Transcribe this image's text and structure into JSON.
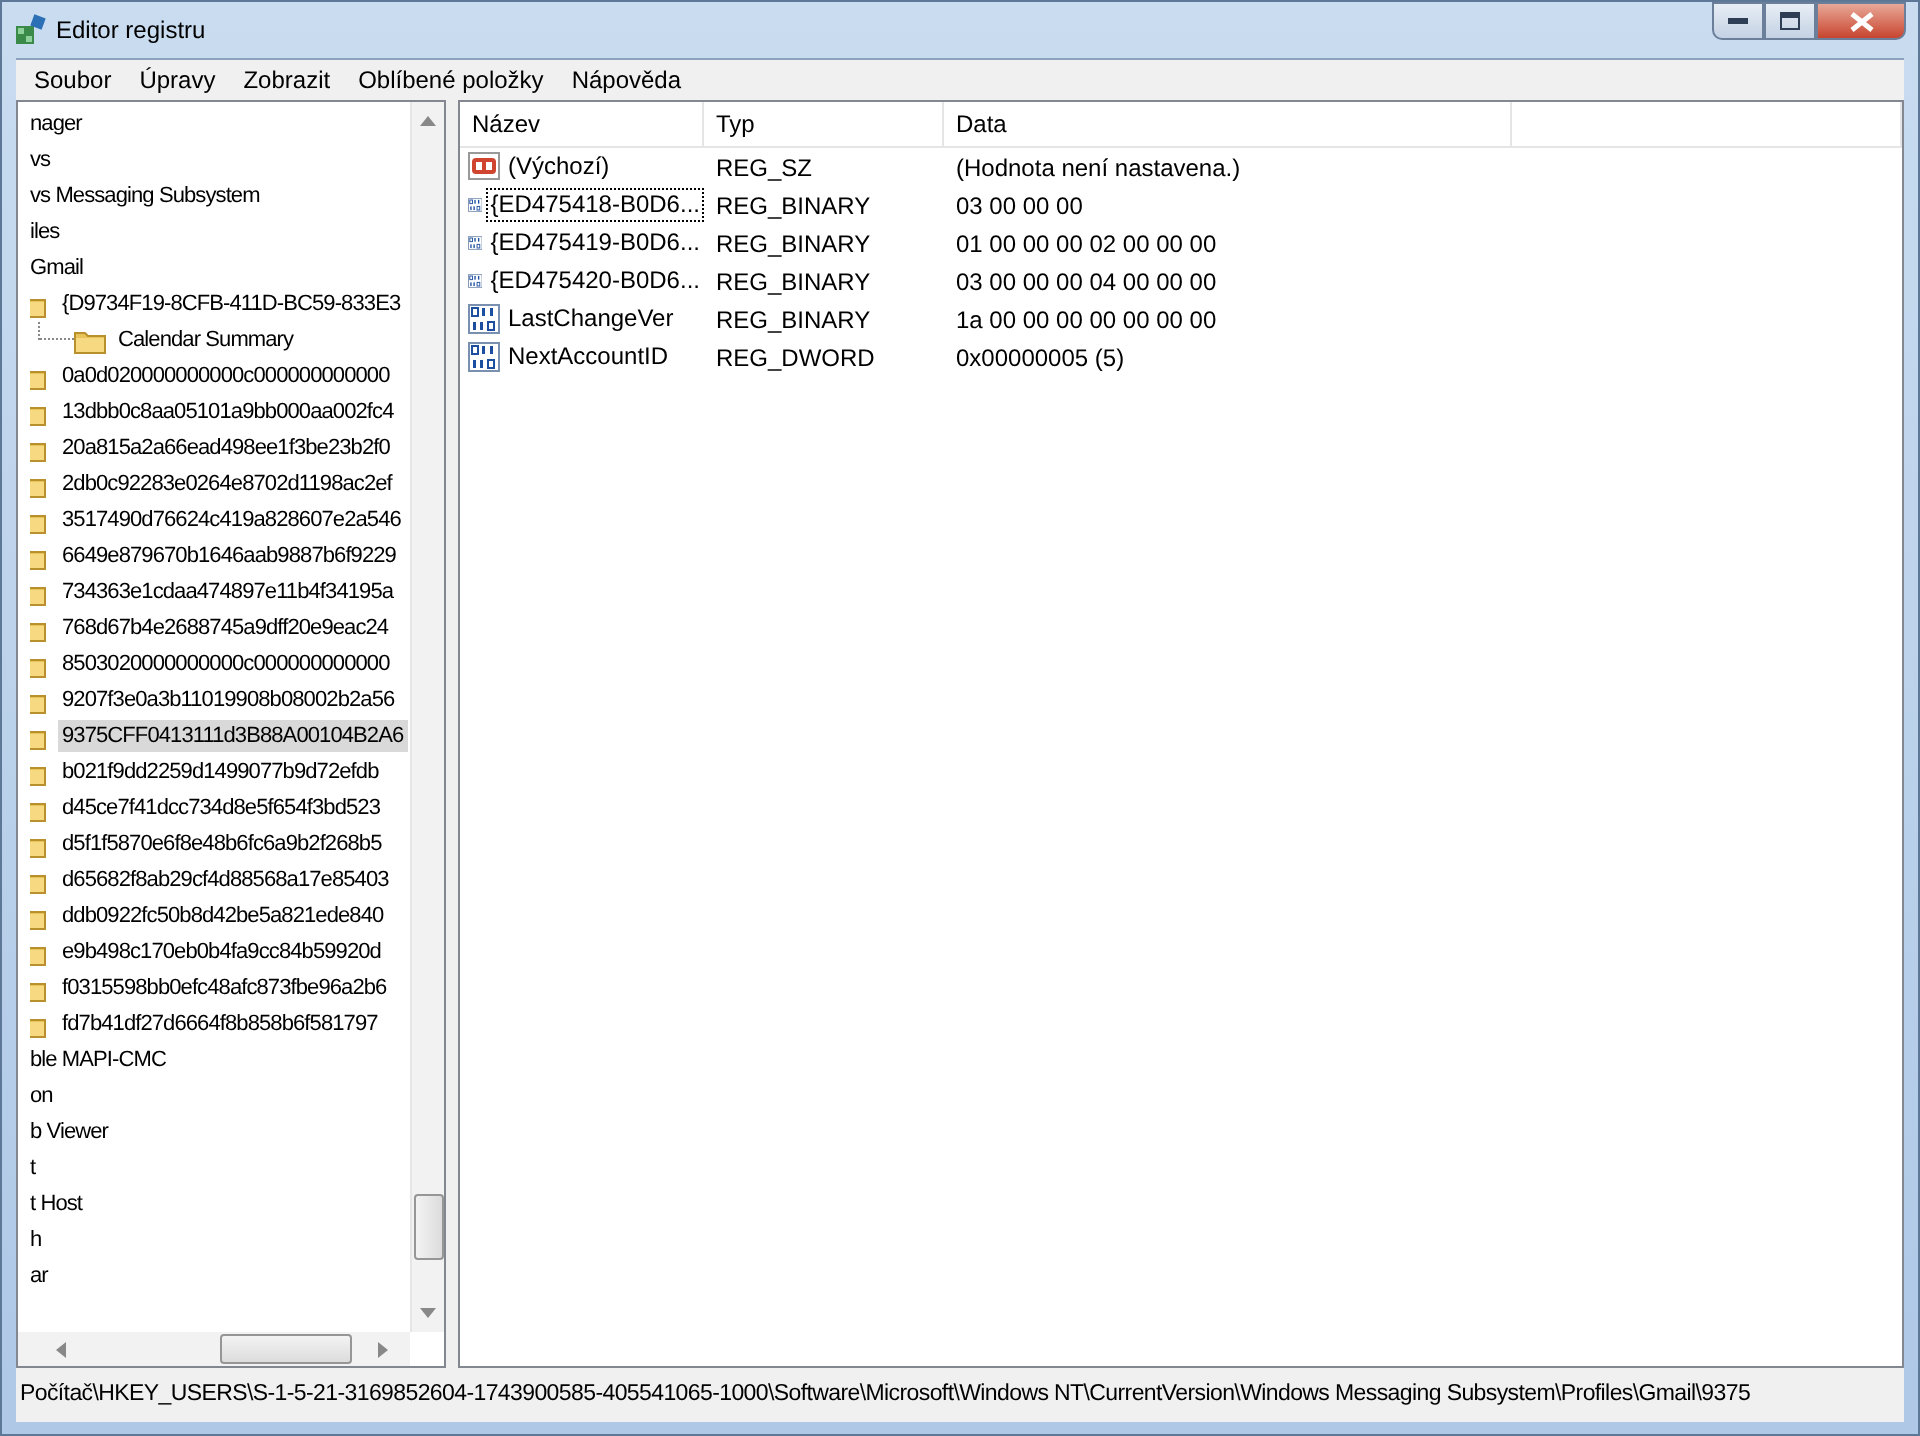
{
  "window": {
    "title": "Editor registru"
  },
  "menu": [
    "Soubor",
    "Úpravy",
    "Zobrazit",
    "Oblíbené položky",
    "Nápověda"
  ],
  "tree": [
    {
      "label": "nager",
      "selected": false
    },
    {
      "label": "vs",
      "selected": false
    },
    {
      "label": "vs Messaging Subsystem",
      "selected": false
    },
    {
      "label": "iles",
      "selected": false
    },
    {
      "label": "Gmail",
      "selected": false,
      "children": [
        {
          "label": "{D9734F19-8CFB-411D-BC59-833E3",
          "selected": false,
          "children": [
            {
              "label": "Calendar Summary",
              "selected": false
            }
          ]
        },
        {
          "label": "0a0d020000000000c000000000000",
          "selected": false
        },
        {
          "label": "13dbb0c8aa05101a9bb000aa002fc4",
          "selected": false
        },
        {
          "label": "20a815a2a66ead498ee1f3be23b2f0",
          "selected": false
        },
        {
          "label": "2db0c92283e0264e8702d1198ac2ef",
          "selected": false
        },
        {
          "label": "3517490d76624c419a828607e2a546",
          "selected": false
        },
        {
          "label": "6649e879670b1646aab9887b6f9229",
          "selected": false
        },
        {
          "label": "734363e1cdaa474897e11b4f34195a",
          "selected": false
        },
        {
          "label": "768d67b4e2688745a9dff20e9eac24",
          "selected": false
        },
        {
          "label": "8503020000000000c000000000000",
          "selected": false
        },
        {
          "label": "9207f3e0a3b11019908b08002b2a56",
          "selected": false
        },
        {
          "label": "9375CFF0413111d3B88A00104B2A6",
          "selected": true
        },
        {
          "label": "b021f9dd2259d1499077b9d72efdb",
          "selected": false
        },
        {
          "label": "d45ce7f41dcc734d8e5f654f3bd523",
          "selected": false
        },
        {
          "label": "d5f1f5870e6f8e48b6fc6a9b2f268b5",
          "selected": false
        },
        {
          "label": "d65682f8ab29cf4d88568a17e85403",
          "selected": false
        },
        {
          "label": "ddb0922fc50b8d42be5a821ede840",
          "selected": false
        },
        {
          "label": "e9b498c170eb0b4fa9cc84b59920d",
          "selected": false
        },
        {
          "label": "f0315598bb0efc48afc873fbe96a2b6",
          "selected": false
        },
        {
          "label": "fd7b41df27d6664f8b858b6f581797",
          "selected": false
        }
      ]
    },
    {
      "label": "ble MAPI-CMC",
      "selected": false
    },
    {
      "label": "on",
      "selected": false
    },
    {
      "label": "b Viewer",
      "selected": false
    },
    {
      "label": "t",
      "selected": false
    },
    {
      "label": "t Host",
      "selected": false
    },
    {
      "label": "h",
      "selected": false
    },
    {
      "label": "ar",
      "selected": false
    }
  ],
  "table": {
    "columns": [
      "Název",
      "Typ",
      "Data"
    ],
    "rows": [
      {
        "kind": "string",
        "name": "(Výchozí)",
        "type": "REG_SZ",
        "data": "(Hodnota není nastavena.)",
        "focused": false
      },
      {
        "kind": "binary",
        "name": "{ED475418-B0D6...",
        "type": "REG_BINARY",
        "data": "03 00 00 00",
        "focused": true
      },
      {
        "kind": "binary",
        "name": "{ED475419-B0D6...",
        "type": "REG_BINARY",
        "data": "01 00 00 00 02 00 00 00",
        "focused": false
      },
      {
        "kind": "binary",
        "name": "{ED475420-B0D6...",
        "type": "REG_BINARY",
        "data": "03 00 00 00 04 00 00 00",
        "focused": false
      },
      {
        "kind": "binary",
        "name": "LastChangeVer",
        "type": "REG_BINARY",
        "data": "1a 00 00 00 00 00 00 00",
        "focused": false
      },
      {
        "kind": "binary",
        "name": "NextAccountID",
        "type": "REG_DWORD",
        "data": "0x00000005 (5)",
        "focused": false
      }
    ]
  },
  "status_bar": "Počítač\\HKEY_USERS\\S-1-5-21-3169852604-1743900585-405541065-1000\\Software\\Microsoft\\Windows NT\\CurrentVersion\\Windows Messaging Subsystem\\Profiles\\Gmail\\9375"
}
